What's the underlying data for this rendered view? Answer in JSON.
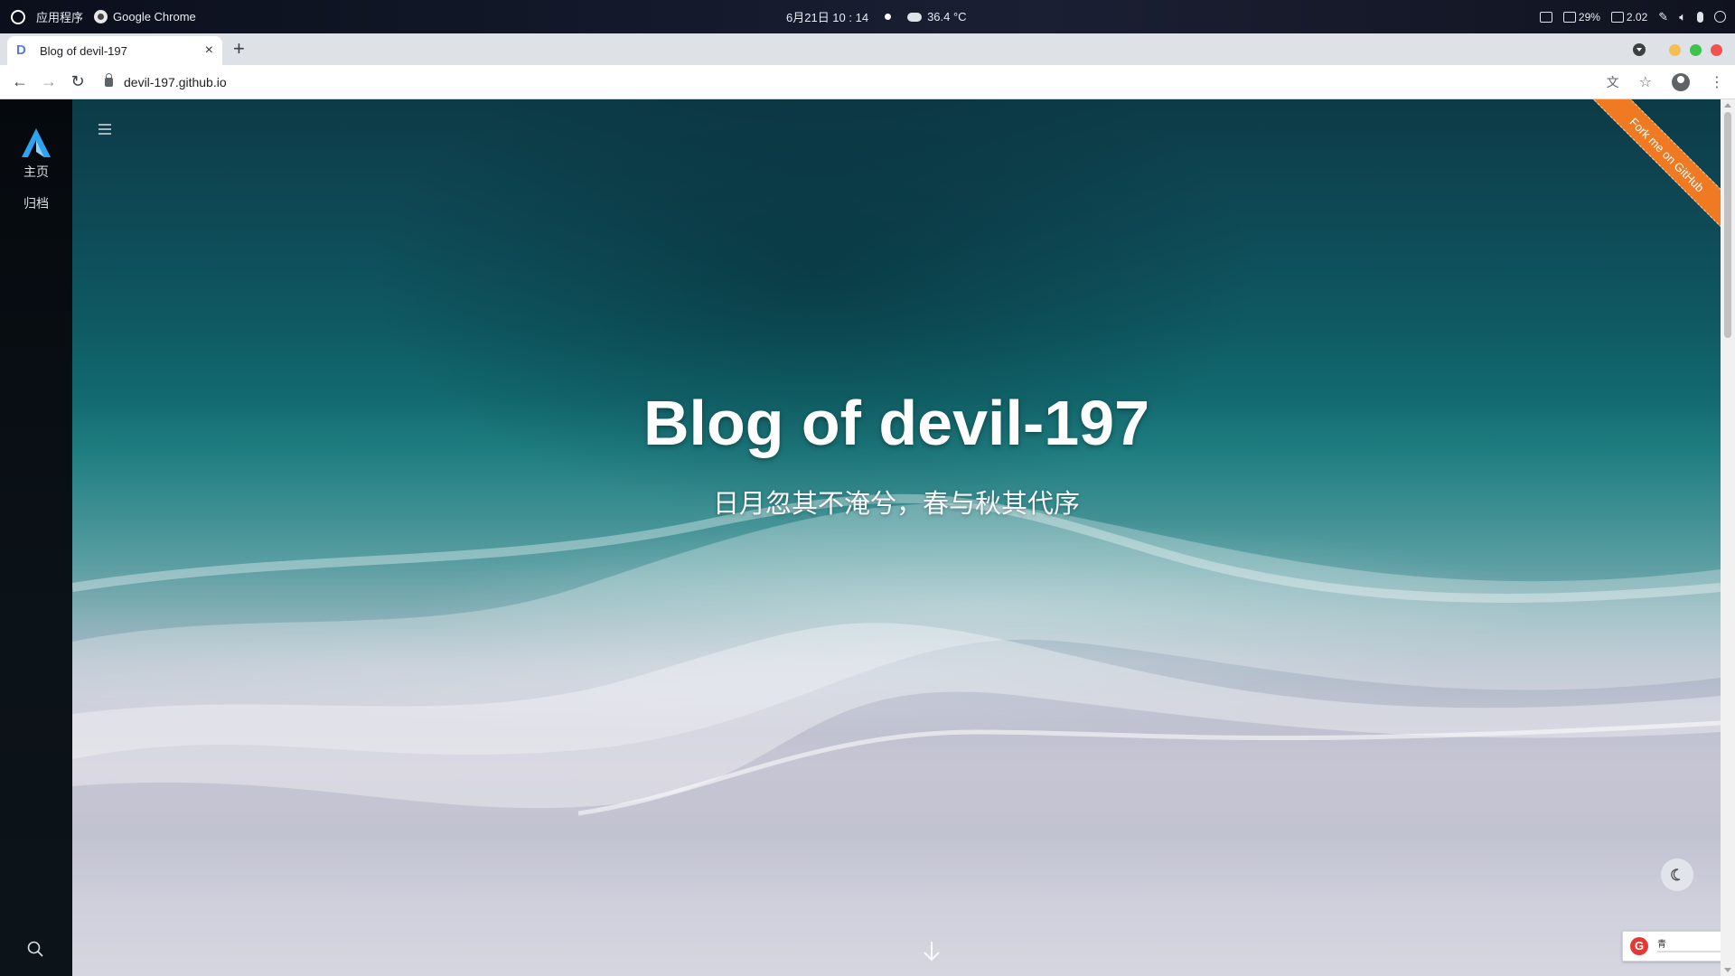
{
  "os_panel": {
    "apps_label": "应用程序",
    "active_app": "Google Chrome",
    "datetime": "6月21日  10 : 14",
    "temperature": "36.4 °C",
    "battery": "29%",
    "network": "2.02"
  },
  "browser": {
    "tab_title": "Blog of devil-197",
    "tab_favicon": "D",
    "new_tab_label": "+",
    "close_label": "×",
    "url": "devil-197.github.io",
    "window_colors": {
      "minimize": "#f5bf4f",
      "maximize": "#3cc24f",
      "close": "#f2514f"
    }
  },
  "sidebar": {
    "items": [
      {
        "label": "主页"
      },
      {
        "label": "归档"
      }
    ]
  },
  "hero": {
    "title": "Blog of devil-197",
    "subtitle": "日月忽其不淹兮，春与秋其代序",
    "ribbon": "Fork me on GitHub"
  },
  "player": {
    "title": "青",
    "brand_icon": "netease-music-icon",
    "accent": "#e53935"
  },
  "colors": {
    "ribbon": "#f07a22",
    "sidebar_bg": "#0b1218",
    "logo_accent": "#2ea3f2"
  }
}
